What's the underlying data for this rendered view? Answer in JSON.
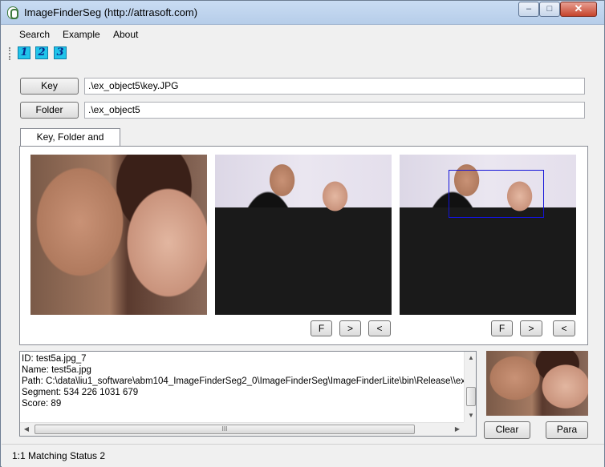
{
  "window": {
    "title": "ImageFinderSeg (http://attrasoft.com)",
    "minimize": "–",
    "maximize": "□",
    "close": "✕"
  },
  "menu": {
    "items": [
      "Search",
      "Example",
      "About"
    ]
  },
  "toolbar": {
    "buttons": [
      "1",
      "2",
      "3"
    ]
  },
  "key": {
    "button": "Key",
    "path": ".\\ex_object5\\key.JPG"
  },
  "folder": {
    "button": "Folder",
    "path": ".\\ex_object5"
  },
  "tab": {
    "label": "Key, Folder and Results"
  },
  "images": {
    "key_image": "key-photo",
    "result_image": "match-photo",
    "result_marked": "match-photo-with-selection"
  },
  "nav1": {
    "first": "F",
    "next": ">",
    "prev": "<"
  },
  "nav2": {
    "first": "F",
    "next": ">",
    "prev": "<"
  },
  "details": {
    "lines": [
      "ID: test5a.jpg_7",
      "Name: test5a.jpg",
      "Path: C:\\data\\liu1_software\\abm104_ImageFinderSeg2_0\\ImageFinderSeg\\ImageFinderLiite\\bin\\Release\\\\ex_obje",
      "Segment: 534 226 1031 679",
      "Score: 89"
    ]
  },
  "scroll": {
    "grip": "III",
    "up": "▲",
    "down": "▼",
    "left": "◀",
    "right": "▶"
  },
  "actions": {
    "clear": "Clear",
    "para": "Para"
  },
  "status": {
    "text": "1:1 Matching  Status 2"
  }
}
